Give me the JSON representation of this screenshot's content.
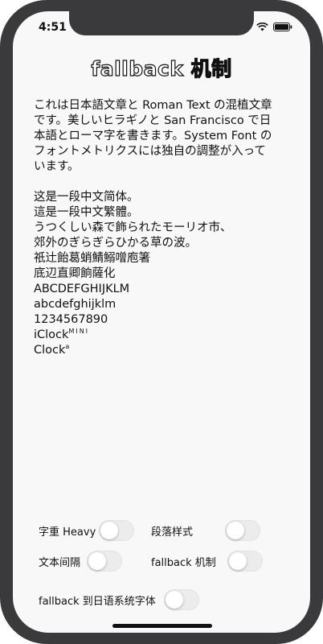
{
  "status": {
    "time": "4:51",
    "icons": [
      "wifi-icon",
      "battery-icon"
    ]
  },
  "title": "fallback 机制",
  "paragraph1": [
    "これは日本語文章と Roman Text の混植文章",
    "です。美しいヒラギノと San Francisco で日",
    "本語とローマ字を書きます。System Font の",
    "フォントメトリクスには独自の調整が入って",
    "います。"
  ],
  "lines": [
    "这是一段中文简体。",
    "這是一段中文繁體。",
    "うつくしい森で飾られたモーリオ市、",
    "郊外のぎらぎらひかる草の波。",
    "祇辻飴葛蛸鯖鰯噌庖箸",
    "底辺直卿餉薩化",
    "ABCDEFGHIJKLM",
    "abcdefghijklm",
    "1234567890"
  ],
  "iclock": {
    "base": "iClock",
    "sup": "MINI"
  },
  "clock": {
    "base": "Clock",
    "sup": "a"
  },
  "controls": {
    "weight_label": "字重 Heavy",
    "paragraph_label": "段落样式",
    "spacing_label": "文本间隔",
    "fallback_label": "fallback 机制",
    "jp_fallback_label": "fallback 到日语系统字体"
  }
}
